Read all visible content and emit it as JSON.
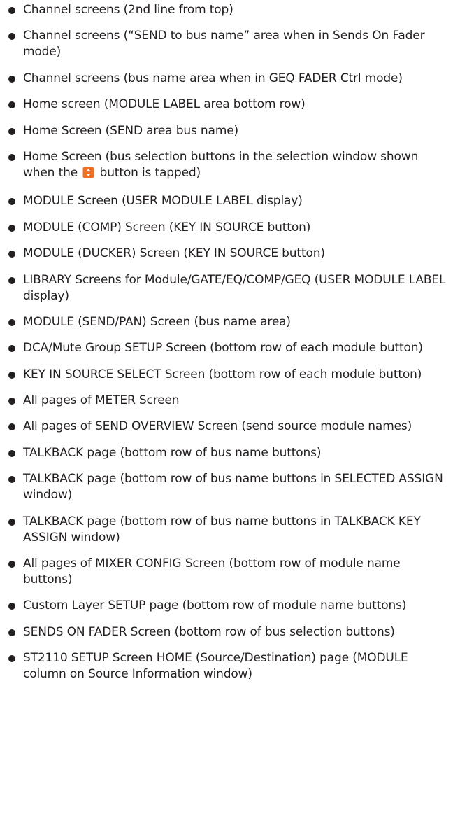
{
  "items": [
    {
      "text": "Channel screens (2nd line from top)"
    },
    {
      "text": "Channel screens (“SEND to bus name” area when in Sends On Fader mode)"
    },
    {
      "text": "Channel screens (bus name area when in GEQ FADER Ctrl mode)"
    },
    {
      "text": "Home screen (MODULE LABEL area bottom row)"
    },
    {
      "text": "Home Screen (SEND area bus name)"
    },
    {
      "text_before": "Home Screen (bus selection buttons in the selection window shown when the",
      "icon": "up-down-selector-icon",
      "text_after": "button is tapped)"
    },
    {
      "text": "MODULE Screen (USER MODULE LABEL display)"
    },
    {
      "text": "MODULE (COMP) Screen (KEY IN SOURCE button)"
    },
    {
      "text": "MODULE (DUCKER) Screen (KEY IN SOURCE button)"
    },
    {
      "text": "LIBRARY Screens for Module/GATE/EQ/COMP/GEQ (USER MODULE LABEL display)"
    },
    {
      "text": "MODULE (SEND/PAN) Screen (bus name area)"
    },
    {
      "text": "DCA/Mute Group SETUP Screen (bottom row of each module button)"
    },
    {
      "text": "KEY IN SOURCE SELECT Screen (bottom row of each module button)"
    },
    {
      "text": "All pages of METER Screen"
    },
    {
      "text": "All pages of SEND OVERVIEW Screen (send source module names)"
    },
    {
      "text": "TALKBACK page (bottom row of bus name buttons)"
    },
    {
      "text": "TALKBACK page (bottom row of bus name buttons in SELECTED ASSIGN window)"
    },
    {
      "text": "TALKBACK page (bottom row of bus name buttons in TALKBACK KEY ASSIGN window)"
    },
    {
      "text": "All pages of MIXER CONFIG Screen (bottom row of module name buttons)"
    },
    {
      "text": "Custom Layer SETUP page (bottom row of module name buttons)"
    },
    {
      "text": "SENDS ON FADER Screen (bottom row of bus selection buttons)"
    },
    {
      "text": "ST2110 SETUP Screen HOME (Source/Destination) page (MODULE column on Source Information window)"
    }
  ],
  "colors": {
    "text": "#231f20",
    "icon_fill": "#f26f21",
    "icon_glyph": "#ffffff"
  }
}
